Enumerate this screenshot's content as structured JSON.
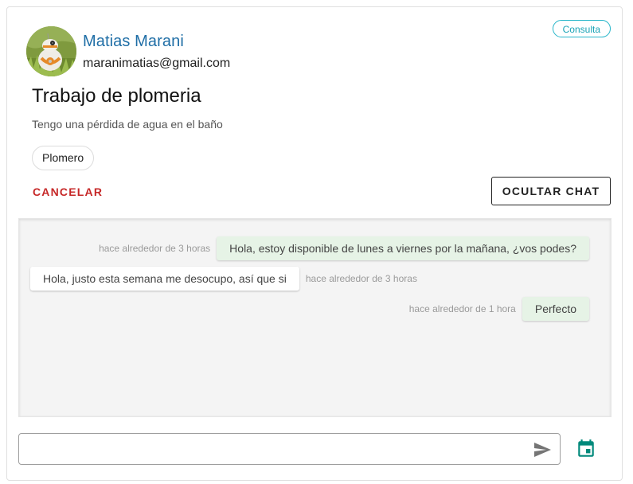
{
  "request": {
    "user_name": "Matias Marani",
    "user_email": "maranimatias@gmail.com",
    "status_badge": "Consulta",
    "title": "Trabajo de plomeria",
    "description": "Tengo una pérdida de agua en el baño",
    "category_chip": "Plomero"
  },
  "actions": {
    "cancel_label": "CANCELAR",
    "hide_chat_label": "OCULTAR CHAT"
  },
  "chat": {
    "messages": [
      {
        "direction": "out",
        "text": "Hola, estoy disponible de lunes a viernes por la mañana, ¿vos podes?",
        "time": "hace alrededor de 3 horas"
      },
      {
        "direction": "in",
        "text": "Hola, justo esta semana me desocupo, así que si",
        "time": "hace alrededor de 3 horas"
      },
      {
        "direction": "out",
        "text": "Perfecto",
        "time": "hace alrededor de 1 hora"
      }
    ],
    "input_value": "",
    "input_placeholder": ""
  },
  "icons": {
    "send": "send-icon",
    "calendar": "calendar-icon"
  },
  "colors": {
    "name": "#1f6ea6",
    "badge": "#26b5c9",
    "cancel": "#c62828",
    "outgoing_bubble": "#e6f3e6",
    "calendar": "#00897b"
  }
}
